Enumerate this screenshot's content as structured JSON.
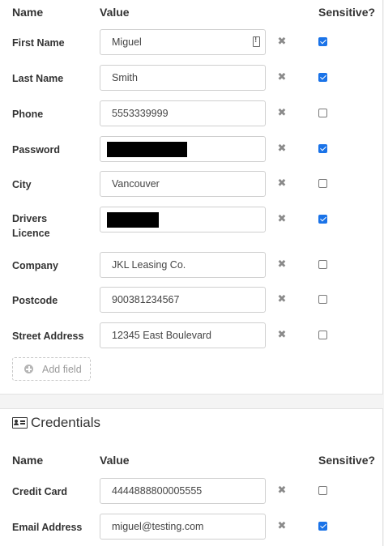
{
  "headers": {
    "name": "Name",
    "value": "Value",
    "sensitive": "Sensitive?"
  },
  "fields": [
    {
      "label": "First Name",
      "value": "Miguel",
      "masked": false,
      "sensitive": true
    },
    {
      "label": "Last Name",
      "value": "Smith",
      "masked": false,
      "sensitive": true
    },
    {
      "label": "Phone",
      "value": "5553339999",
      "masked": false,
      "sensitive": false
    },
    {
      "label": "Password",
      "value": "",
      "masked": true,
      "sensitive": true
    },
    {
      "label": "City",
      "value": "Vancouver",
      "masked": false,
      "sensitive": false
    },
    {
      "label": "Drivers Licence",
      "value": "",
      "masked": true,
      "sensitive": true
    },
    {
      "label": "Company",
      "value": "JKL Leasing Co.",
      "masked": false,
      "sensitive": false
    },
    {
      "label": "Postcode",
      "value": "900381234567",
      "masked": false,
      "sensitive": false
    },
    {
      "label": "Street Address",
      "value": "12345 East Boulevard",
      "masked": false,
      "sensitive": false
    }
  ],
  "add_field_label": "Add field",
  "credentials": {
    "title": "Credentials",
    "headers": {
      "name": "Name",
      "value": "Value",
      "sensitive": "Sensitive?"
    },
    "fields": [
      {
        "label": "Credit Card",
        "value": "4444888800005555",
        "sensitive": false
      },
      {
        "label": "Email Address",
        "value": "miguel@testing.com",
        "sensitive": true
      }
    ]
  },
  "icons": {
    "remove": "close-icon",
    "add": "plus-circle-icon",
    "section": "id-card-icon",
    "password_manager": "password-manager-icon"
  },
  "colors": {
    "checkbox_checked": "#1a73e8",
    "remove_icon": "#8a8a8a"
  }
}
